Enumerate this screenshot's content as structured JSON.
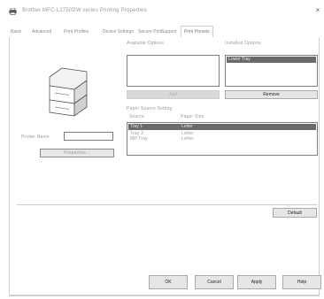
{
  "window": {
    "title": "Brother MFC-L2750DW series Printing Properties",
    "icon": "printer-icon",
    "close_glyph": "×"
  },
  "tabs": [
    {
      "label": "Basic"
    },
    {
      "label": "Advanced"
    },
    {
      "label": "Print Profiles"
    },
    {
      "label": "Device Settings"
    },
    {
      "label": "Secure Print"
    },
    {
      "label": "Support"
    },
    {
      "label": "Print Presets"
    }
  ],
  "printer": {
    "name_label": "Printer Name",
    "name_value": "",
    "properties_button": "Properties..."
  },
  "lists": {
    "available_label": "Available Options",
    "installed_label": "Installed Options",
    "available_items": [],
    "installed_items": [
      "Lower Tray"
    ],
    "add_button": "Add",
    "remove_button": "Remove"
  },
  "paper_source": {
    "label": "Paper Source Setting",
    "col_source": "Source",
    "col_paper_size": "Paper Size",
    "rows": [
      {
        "source": "Tray 1",
        "size": "Letter"
      },
      {
        "source": "Tray 2",
        "size": "Letter"
      },
      {
        "source": "MP Tray",
        "size": "Letter"
      }
    ]
  },
  "default_button": "Default",
  "footer": {
    "ok": "OK",
    "cancel": "Cancel",
    "apply": "Apply",
    "help": "Help"
  }
}
